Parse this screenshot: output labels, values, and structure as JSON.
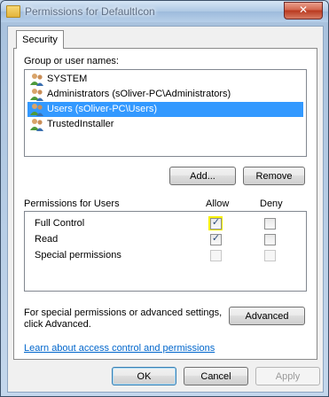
{
  "window": {
    "title": "Permissions for DefaultIcon",
    "close_glyph": "✕"
  },
  "tabs": [
    {
      "label": "Security"
    }
  ],
  "group_section": {
    "label": "Group or user names:",
    "items": [
      {
        "label": "SYSTEM",
        "icon": "users-icon",
        "selected": false
      },
      {
        "label": "Administrators (sOliver-PC\\Administrators)",
        "icon": "users-icon",
        "selected": false
      },
      {
        "label": "Users (sOliver-PC\\Users)",
        "icon": "users-icon",
        "selected": true
      },
      {
        "label": "TrustedInstaller",
        "icon": "users-icon",
        "selected": false
      }
    ],
    "add_button": "Add...",
    "remove_button": "Remove"
  },
  "permissions": {
    "header": "Permissions for Users",
    "allow_header": "Allow",
    "deny_header": "Deny",
    "rows": [
      {
        "name": "Full Control",
        "allow": true,
        "deny": false,
        "allow_highlighted": true
      },
      {
        "name": "Read",
        "allow": true,
        "deny": false
      },
      {
        "name": "Special permissions",
        "allow": false,
        "deny": false
      }
    ]
  },
  "special": {
    "text_line1": "For special permissions or advanced settings,",
    "text_line2": "click Advanced.",
    "advanced_button": "Advanced"
  },
  "link": "Learn about access control and permissions",
  "footer": {
    "ok": "OK",
    "cancel": "Cancel",
    "apply": "Apply"
  },
  "colors": {
    "selection": "#3399ff",
    "highlight": "#f7f100",
    "link": "#0066cc"
  }
}
